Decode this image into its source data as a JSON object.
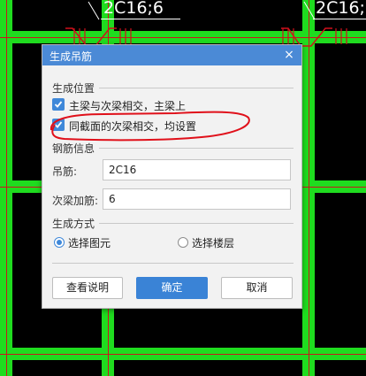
{
  "background": {
    "labels": [
      "2C16;6",
      "2C16;6"
    ]
  },
  "dialog": {
    "title": "生成吊筋",
    "close_glyph": "×",
    "position_section": {
      "title": "生成位置",
      "options": [
        {
          "label": "主梁与次梁相交，主梁上",
          "checked": true
        },
        {
          "label": "同截面的次梁相交，均设置",
          "checked": true
        }
      ]
    },
    "rebar_section": {
      "title": "钢筋信息",
      "hanger_label": "吊筋:",
      "hanger_value": "2C16",
      "stirrup_label": "次梁加筋:",
      "stirrup_value": "6"
    },
    "mode_section": {
      "title": "生成方式",
      "options": [
        {
          "label": "选择图元",
          "selected": true
        },
        {
          "label": "选择楼层",
          "selected": false
        }
      ]
    },
    "buttons": {
      "help": "查看说明",
      "ok": "确定",
      "cancel": "取消"
    }
  },
  "colors": {
    "beam": "#1fdc1f",
    "accent": "#3a83d6",
    "annotation": "#e0101a"
  }
}
